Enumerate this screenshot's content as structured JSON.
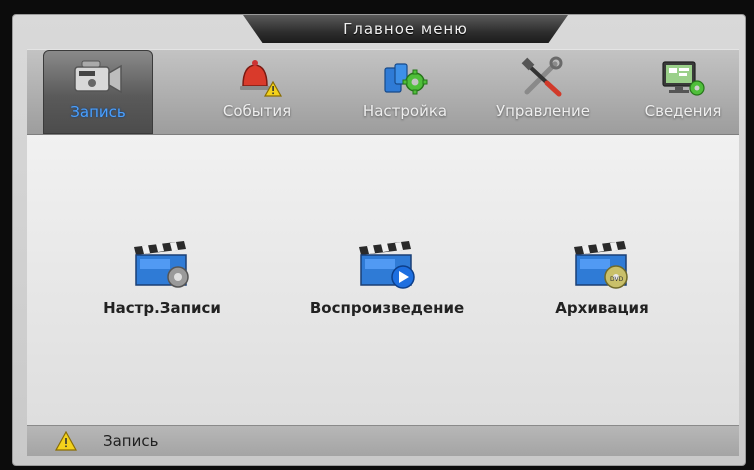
{
  "window": {
    "title": "Главное меню"
  },
  "tabs": [
    {
      "label": "Запись",
      "icon": "camera-icon",
      "active": true
    },
    {
      "label": "События",
      "icon": "alarm-bell-icon",
      "active": false
    },
    {
      "label": "Настройка",
      "icon": "settings-gears-icon",
      "active": false
    },
    {
      "label": "Управление",
      "icon": "tools-icon",
      "active": false
    },
    {
      "label": "Сведения",
      "icon": "system-info-icon",
      "active": false
    }
  ],
  "menu_items": [
    {
      "label": "Настр.Записи",
      "icon": "record-settings-icon"
    },
    {
      "label": "Воспроизведение",
      "icon": "playback-icon"
    },
    {
      "label": "Архивация",
      "icon": "backup-icon"
    }
  ],
  "status": {
    "text": "Запись",
    "icon": "warning-icon"
  },
  "colors": {
    "active_tab_label": "#4aa0ff",
    "panel_background": "#d9d9d9",
    "title_bar": "#2e2e2e"
  }
}
